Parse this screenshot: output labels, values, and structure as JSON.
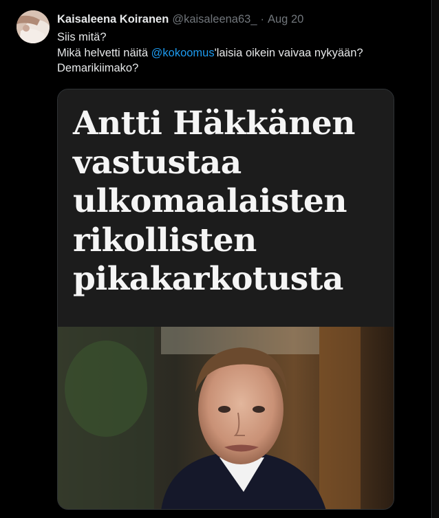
{
  "tweet": {
    "author": {
      "display_name": "Kaisaleena Koiranen",
      "handle": "@kaisaleena63_",
      "separator": "·",
      "date": "Aug 20"
    },
    "text": {
      "line1": "Siis mitä?",
      "line2_before": "Mikä helvetti näitä ",
      "mention": "@kokoomus",
      "line2_after": "'laisia oikein vaivaa nykyään?",
      "line3": "Demarikiimako?"
    },
    "media": {
      "headline_lines": [
        "Antti Häkkänen",
        "vastustaa",
        "ulkomaalaisten",
        "rikollisten",
        "pikakarkotusta"
      ],
      "photo_icon": "portrait-photo"
    }
  },
  "colors": {
    "background": "#000000",
    "text": "#e7e9ea",
    "muted": "#71767b",
    "link": "#1d9bf0",
    "border": "#2f3336"
  }
}
